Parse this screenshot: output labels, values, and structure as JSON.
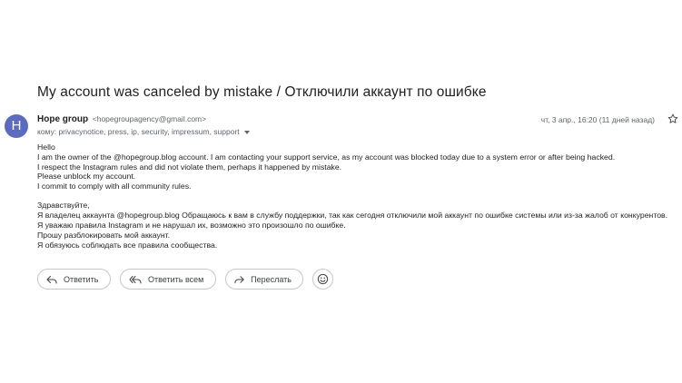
{
  "email": {
    "subject": "My account was canceled by mistake / Отключили аккаунт по ошибке",
    "avatar_letter": "H",
    "avatar_color": "#5c6bc0",
    "sender_name": "Hope group",
    "sender_email": "<hopegroupagency@gmail.com>",
    "recipients": "кому: privacynotice, press, ip, security, impressum, support",
    "date": "чт, 3 апр., 16:20 (11 дней назад)",
    "body_en": [
      "Hello",
      "I am the owner of the @hopegroup.blog account. I am contacting your support service, as my account was blocked today due to a system error or after being hacked.",
      "I respect the Instagram rules and did not violate them, perhaps it happened by mistake.",
      "Please unblock my account.",
      "I commit to comply with all community rules."
    ],
    "body_ru": [
      "Здравствуйте,",
      "Я владелец аккаунта @hopegroup.blog Обращаюсь к вам в службу поддержки, так как сегодня отключили мой аккаунт по ошибке системы или из-за жалоб от конкурентов.",
      "Я уважаю правила Instagram и не нарушал их, возможно это произошло по ошибке.",
      "Прошу разблокировать мой аккаунт.",
      "Я обязуюсь соблюдать все правила сообщества."
    ]
  },
  "actions": {
    "reply_label": "Ответить",
    "reply_all_label": "Ответить всем",
    "forward_label": "Переслать",
    "reply_icon": "reply-icon",
    "reply_all_icon": "reply-all-icon",
    "forward_icon": "forward-icon",
    "emoji_icon": "emoji-icon",
    "star_icon": "star-icon"
  }
}
